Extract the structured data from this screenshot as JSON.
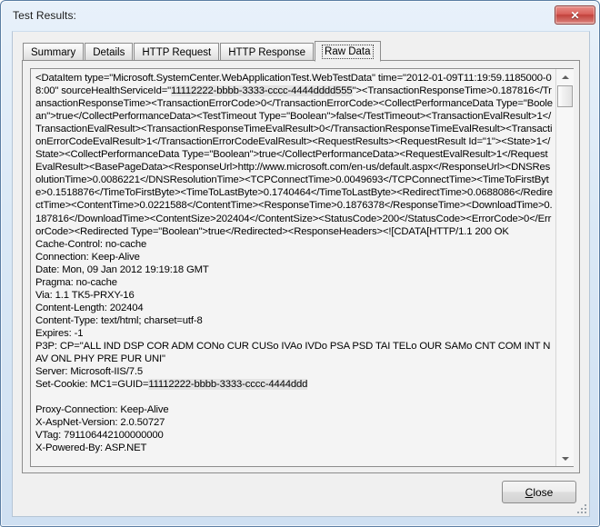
{
  "window": {
    "title": "Test Results:",
    "close_icon": "close-x-icon",
    "close_glyph": "✕"
  },
  "tabs": [
    {
      "label": "Summary",
      "selected": false
    },
    {
      "label": "Details",
      "selected": false
    },
    {
      "label": "HTTP Request",
      "selected": false
    },
    {
      "label": "HTTP Response",
      "selected": false
    },
    {
      "label": "Raw Data",
      "selected": true
    }
  ],
  "raw_data": {
    "xml_part_1": "<DataItem type=\"Microsoft.SystemCenter.WebApplicationTest.WebTestData\" time=\"2012-01-09T11:19:59.1185000-08:00\" sourceHealthServiceId=\"",
    "guid_1": "11112222-bbbb-3333-cccc-4444dddd555",
    "xml_part_2": "\"><TransactionResponseTime>0.187816</TransactionResponseTime><TransactionErrorCode>0</TransactionErrorCode><CollectPerformanceData Type=\"Boolean\">true</CollectPerformanceData><TestTimeout Type=\"Boolean\">false</TestTimeout><TransactionEvalResult>1</TransactionEvalResult><TransactionResponseTimeEvalResult>0</TransactionResponseTimeEvalResult><TransactionErrorCodeEvalResult>1</TransactionErrorCodeEvalResult><RequestResults><RequestResult Id=\"1\"><State>1</State><CollectPerformanceData Type=\"Boolean\">true</CollectPerformanceData><RequestEvalResult>1</RequestEvalResult><BasePageData><ResponseUrl>http://www.microsoft.com/en-us/default.aspx</ResponseUrl><DNSResolutionTime>0.0086221</DNSResolutionTime><TCPConnectTime>0.0049693</TCPConnectTime><TimeToFirstByte>0.1518876</TimeToFirstByte><TimeToLastByte>0.1740464</TimeToLastByte><RedirectTime>0.0688086</RedirectTime><ContentTime>0.0221588</ContentTime><ResponseTime>0.1876378</ResponseTime><DownloadTime>0.187816</DownloadTime><ContentSize>202404</ContentSize><StatusCode>200</StatusCode><ErrorCode>0</ErrorCode><Redirected Type=\"Boolean\">true</Redirected><ResponseHeaders><![CDATA[HTTP/1.1 200 OK",
    "headers_part_1": "Cache-Control: no-cache\nConnection: Keep-Alive\nDate: Mon, 09 Jan 2012 19:19:18 GMT\nPragma: no-cache\nVia: 1.1 TK5-PRXY-16\nContent-Length: 202404\nContent-Type: text/html; charset=utf-8\nExpires: -1\nP3P: CP=\"ALL IND DSP COR ADM CONo CUR CUSo IVAo IVDo PSA PSD TAI TELo OUR SAMo CNT COM INT NAV ONL PHY PRE PUR UNI\"\nServer: Microsoft-IIS/7.5\nSet-Cookie: MC1=GUID=",
    "guid_2": "11112222-bbbb-3333-cccc-4444ddd",
    "headers_part_2": "\n\nProxy-Connection: Keep-Alive\nX-AspNet-Version: 2.0.50727\nVTag: 791106442100000000\nX-Powered-By: ASP.NET\n"
  },
  "scrollbar": {
    "up_icon": "scroll-up-arrow-icon",
    "down_icon": "scroll-down-arrow-icon"
  },
  "footer": {
    "close_accel": "C",
    "close_rest": "lose"
  }
}
